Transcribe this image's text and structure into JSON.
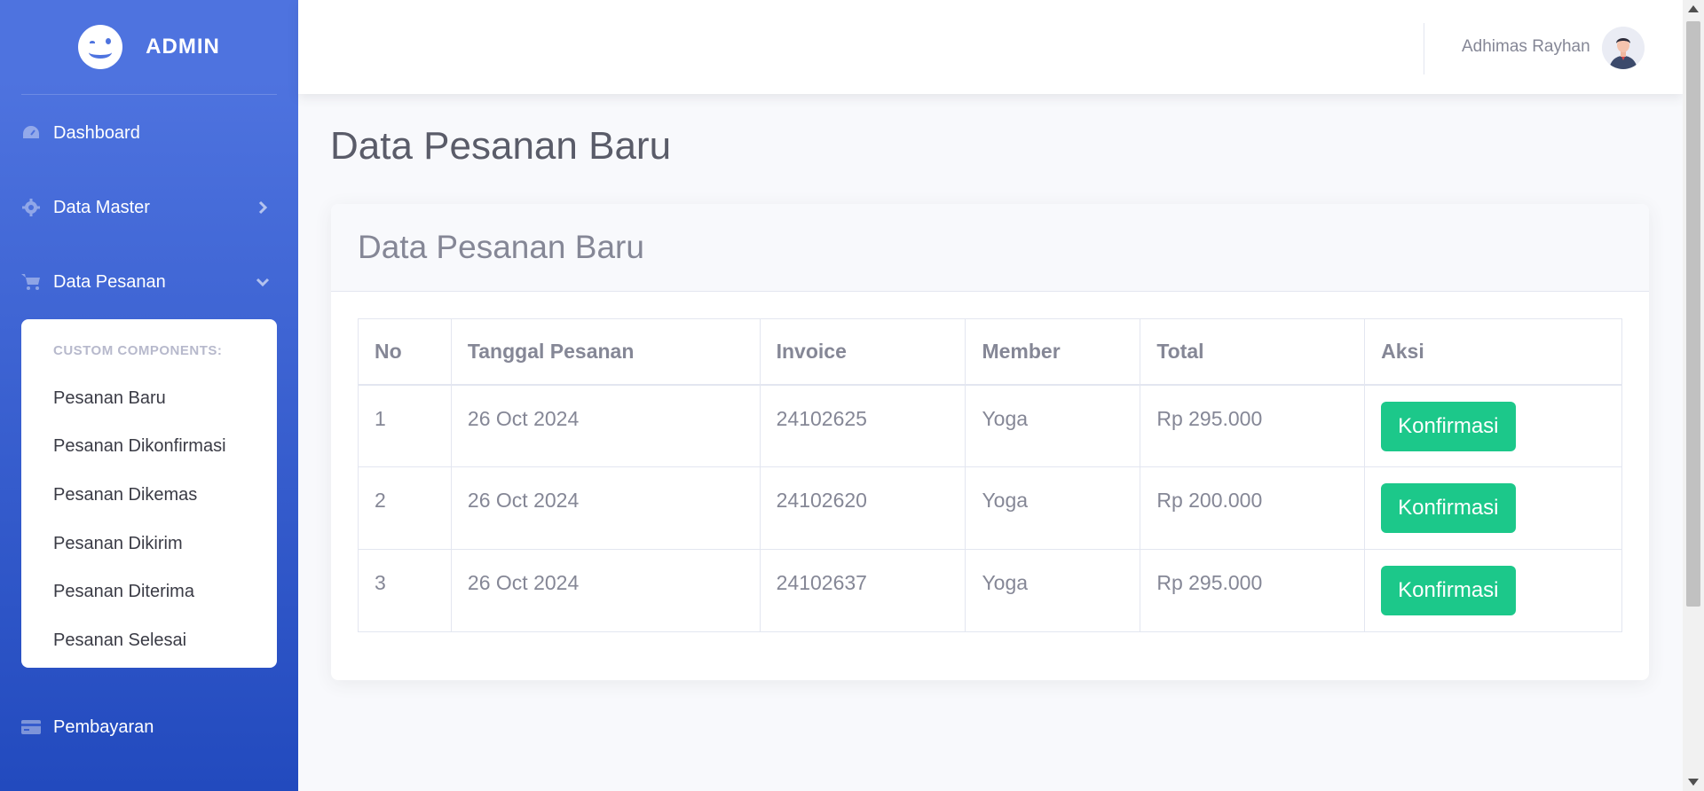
{
  "brand": {
    "name": "ADMIN"
  },
  "sidebar": {
    "items": [
      {
        "label": "Dashboard",
        "icon": "gauge-icon"
      },
      {
        "label": "Data Master",
        "icon": "gear-icon"
      },
      {
        "label": "Data Pesanan",
        "icon": "cart-icon"
      },
      {
        "label": "Pembayaran",
        "icon": "credit-card-icon"
      }
    ],
    "submenu": {
      "header": "CUSTOM COMPONENTS:",
      "items": [
        "Pesanan Baru",
        "Pesanan Dikonfirmasi",
        "Pesanan Dikemas",
        "Pesanan Dikirim",
        "Pesanan Diterima",
        "Pesanan Selesai"
      ]
    }
  },
  "topbar": {
    "user_name": "Adhimas Rayhan"
  },
  "page": {
    "title": "Data Pesanan Baru"
  },
  "card": {
    "title": "Data Pesanan Baru"
  },
  "table": {
    "headers": [
      "No",
      "Tanggal Pesanan",
      "Invoice",
      "Member",
      "Total",
      "Aksi"
    ],
    "rows": [
      {
        "no": "1",
        "date": "26 Oct 2024",
        "invoice": "24102625",
        "member": "Yoga",
        "total": "Rp 295.000",
        "action": "Konfirmasi"
      },
      {
        "no": "2",
        "date": "26 Oct 2024",
        "invoice": "24102620",
        "member": "Yoga",
        "total": "Rp 200.000",
        "action": "Konfirmasi"
      },
      {
        "no": "3",
        "date": "26 Oct 2024",
        "invoice": "24102637",
        "member": "Yoga",
        "total": "Rp 295.000",
        "action": "Konfirmasi"
      }
    ]
  },
  "colors": {
    "primary": "#4e73df",
    "success": "#1cc88a",
    "text": "#858796"
  }
}
